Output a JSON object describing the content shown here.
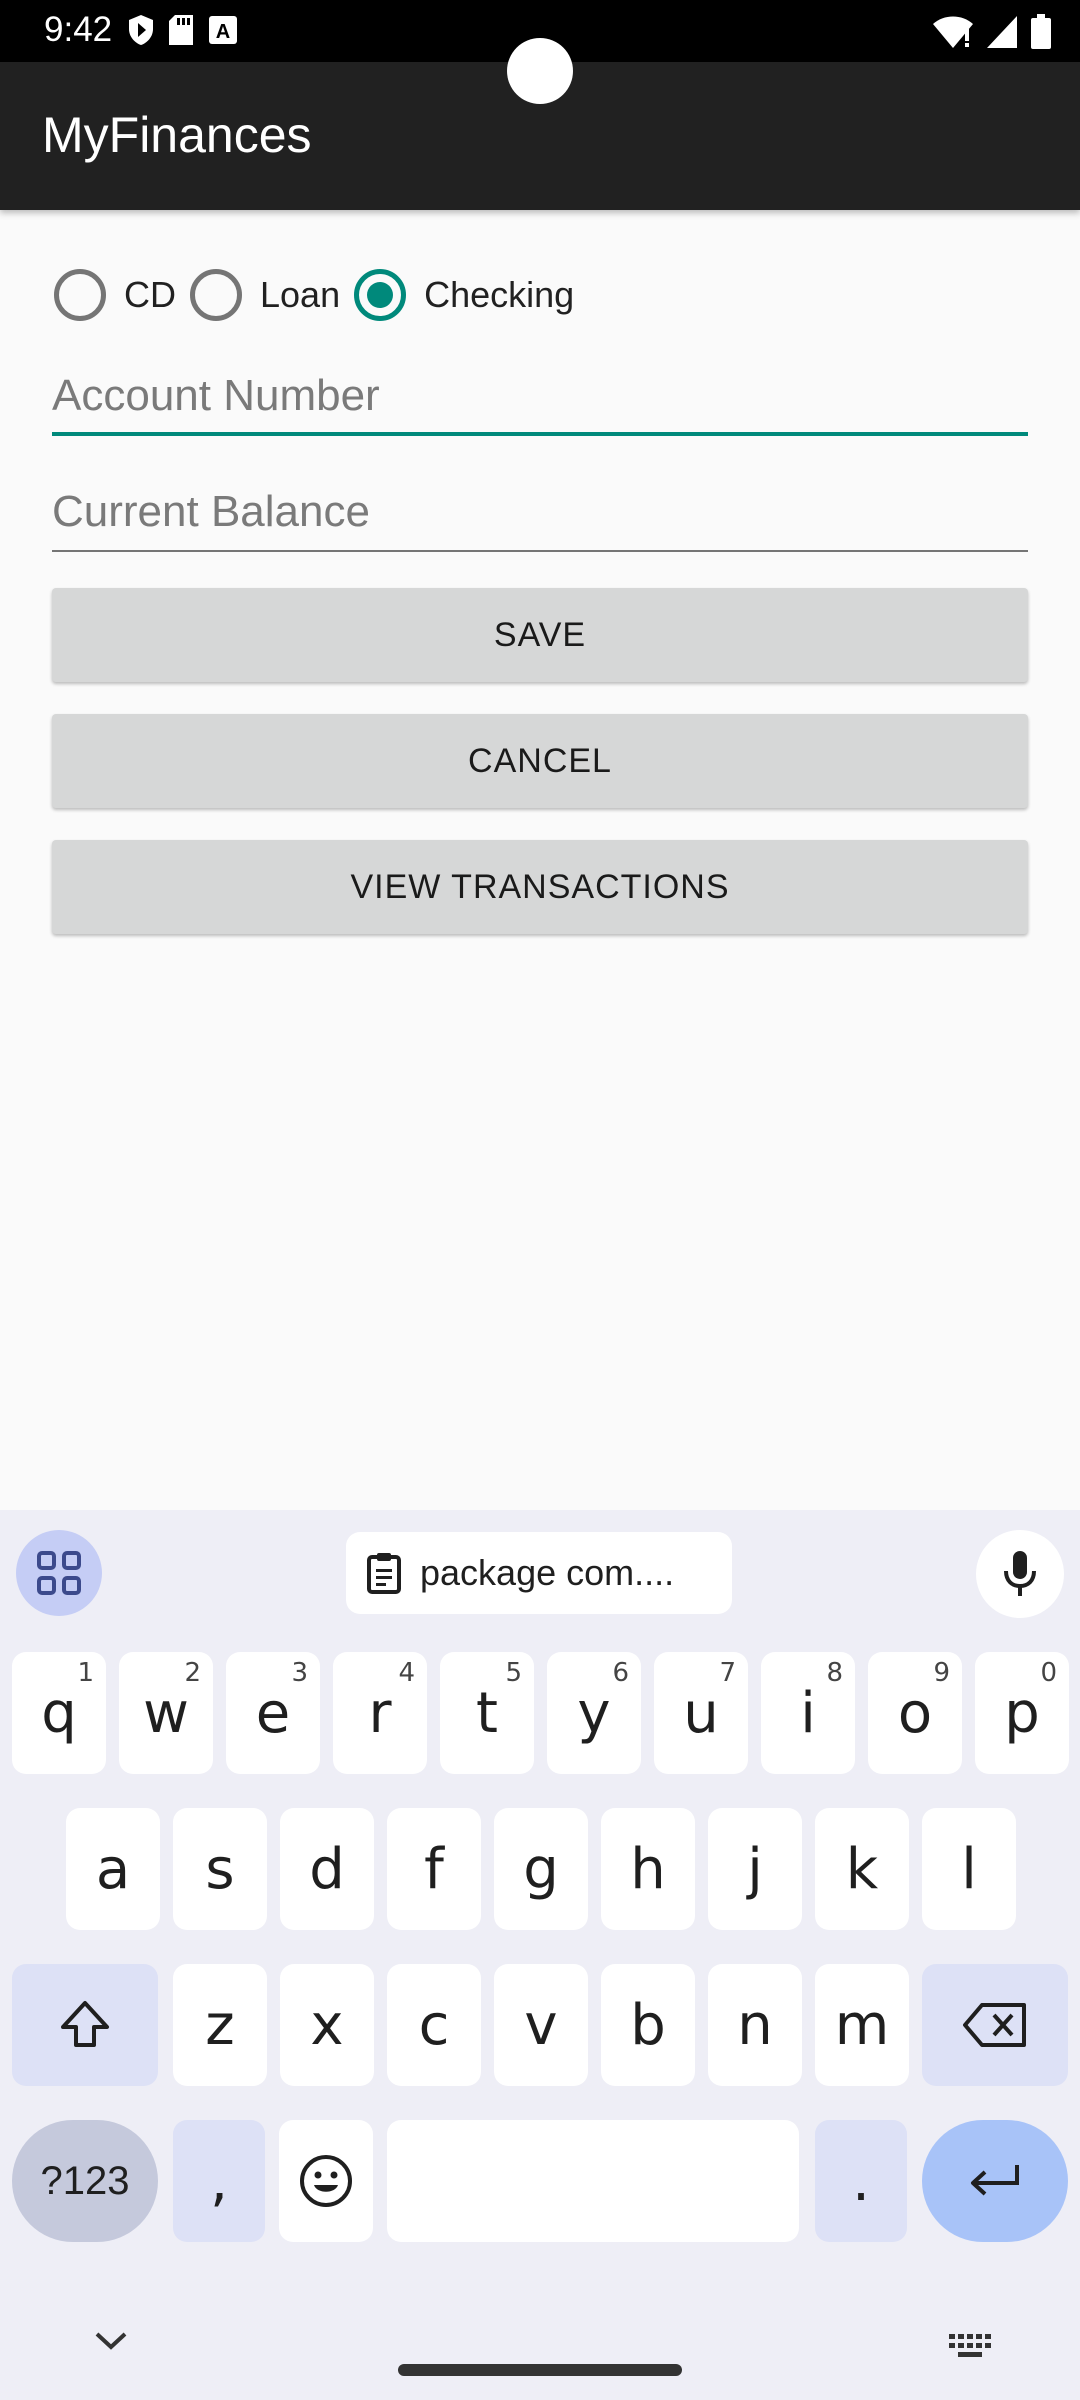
{
  "status_bar": {
    "time": "9:42",
    "left_icons": [
      "shield-icon",
      "sd-card-icon",
      "keyboard-a-icon"
    ],
    "right_icons": [
      "wifi-icon",
      "signal-icon",
      "battery-icon"
    ]
  },
  "app_bar": {
    "title": "MyFinances"
  },
  "account_types": [
    {
      "label": "CD",
      "checked": false
    },
    {
      "label": "Loan",
      "checked": false
    },
    {
      "label": "Checking",
      "checked": true
    }
  ],
  "form": {
    "account_number": {
      "placeholder": "Account Number",
      "value": ""
    },
    "current_balance": {
      "placeholder": "Current Balance",
      "value": ""
    }
  },
  "buttons": {
    "save": "SAVE",
    "cancel": "CANCEL",
    "view_transactions": "VIEW TRANSACTIONS"
  },
  "keyboard": {
    "clipboard_suggestion": "package com....",
    "row1": [
      {
        "key": "q",
        "hint": "1"
      },
      {
        "key": "w",
        "hint": "2"
      },
      {
        "key": "e",
        "hint": "3"
      },
      {
        "key": "r",
        "hint": "4"
      },
      {
        "key": "t",
        "hint": "5"
      },
      {
        "key": "y",
        "hint": "6"
      },
      {
        "key": "u",
        "hint": "7"
      },
      {
        "key": "i",
        "hint": "8"
      },
      {
        "key": "o",
        "hint": "9"
      },
      {
        "key": "p",
        "hint": "0"
      }
    ],
    "row2": [
      "a",
      "s",
      "d",
      "f",
      "g",
      "h",
      "j",
      "k",
      "l"
    ],
    "row3": [
      "z",
      "x",
      "c",
      "v",
      "b",
      "n",
      "m"
    ],
    "symbols_key": "?123",
    "comma_key": ",",
    "period_key": ".",
    "accent_color": "#00897b"
  }
}
